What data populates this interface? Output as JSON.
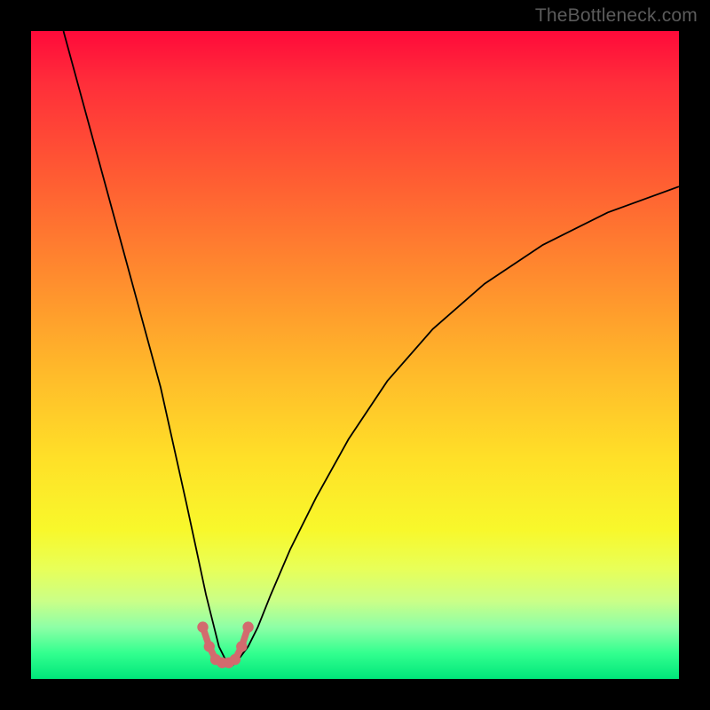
{
  "watermark": "TheBottleneck.com",
  "chart_data": {
    "type": "line",
    "title": "",
    "xlabel": "",
    "ylabel": "",
    "xlim": [
      0,
      100
    ],
    "ylim": [
      0,
      100
    ],
    "grid": false,
    "legend": false,
    "background": "rainbow-gradient-vertical",
    "series": [
      {
        "name": "curve",
        "x": [
          5,
          8,
          11,
          14,
          17,
          20,
          22,
          24,
          25.5,
          27,
          28,
          29,
          30,
          31,
          32,
          33.5,
          35,
          37,
          40,
          44,
          49,
          55,
          62,
          70,
          79,
          89,
          100
        ],
        "y": [
          100,
          89,
          78,
          67,
          56,
          45,
          36,
          27,
          20,
          13,
          9,
          5,
          3,
          2,
          3,
          5,
          8,
          13,
          20,
          28,
          37,
          46,
          54,
          61,
          67,
          72,
          76
        ],
        "stroke": "#000000"
      },
      {
        "name": "bottom-beads",
        "x": [
          26.5,
          27.5,
          28.5,
          29.5,
          30.5,
          31.5,
          32.5,
          33.5
        ],
        "y": [
          8,
          5,
          3,
          2.5,
          2.5,
          3,
          5,
          8
        ],
        "stroke": "#d26b6e",
        "marker": "circle"
      }
    ]
  }
}
